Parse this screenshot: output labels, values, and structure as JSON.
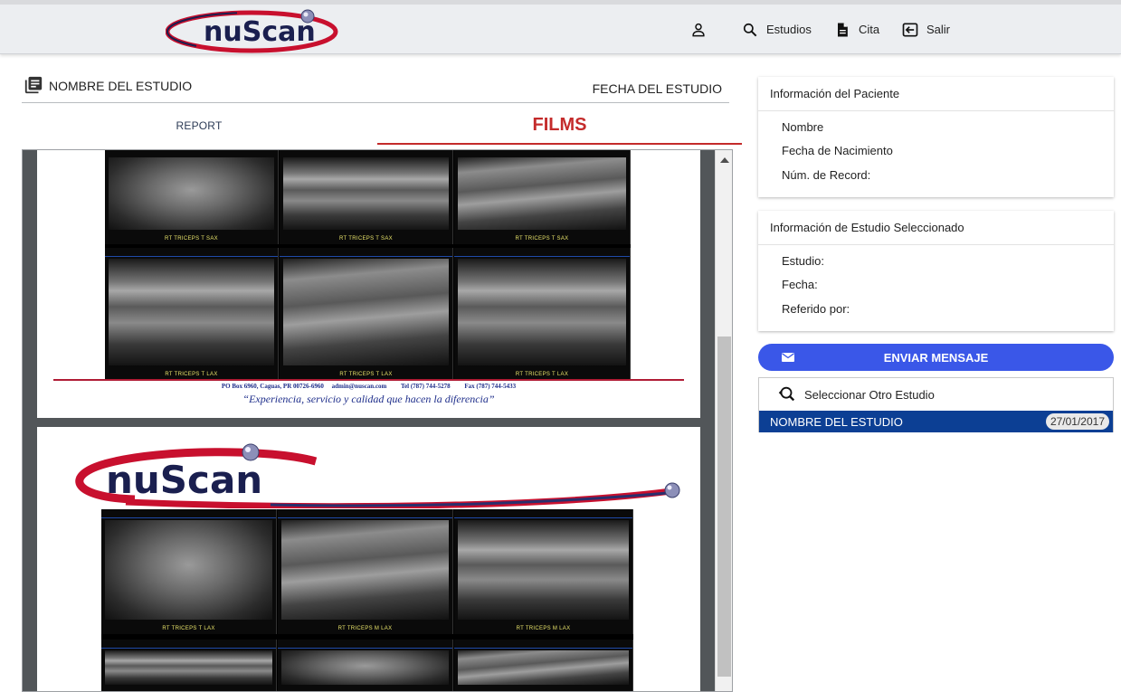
{
  "header": {
    "logo_text": "nuScan",
    "nav": {
      "estudios": "Estudios",
      "cita": "Cita",
      "salir": "Salir"
    },
    "icons": [
      "user-icon",
      "search-icon",
      "document-icon",
      "logout-icon"
    ]
  },
  "study": {
    "name_label": "NOMBRE DEL ESTUDIO",
    "date_label": "FECHA DEL ESTUDIO"
  },
  "tabs": {
    "report": "REPORT",
    "films": "FILMS",
    "active": "films"
  },
  "viewer": {
    "page1": {
      "row1_labels": [
        "RT TRICEPS T SAX",
        "RT TRICEPS T SAX",
        "RT TRICEPS T SAX"
      ],
      "row2_labels": [
        "RT TRICEPS T LAX",
        "RT TRICEPS T LAX",
        "RT TRICEPS T LAX"
      ],
      "footer": {
        "address": "PO Box 6960, Caguas, PR 00726-6960",
        "email": "admin@nuscan.com",
        "tel": "Tel (787) 744-5278",
        "fax": "Fax (787) 744-5433",
        "slogan": "“Experiencia, servicio y calidad que hacen la diferencia”"
      }
    },
    "page2": {
      "logo_text": "nuScan",
      "row1_labels": [
        "RT TRICEPS T LAX",
        "RT TRICEPS M LAX",
        "RT TRICEPS M LAX"
      ]
    }
  },
  "patient_card": {
    "title": "Información del Paciente",
    "fields": [
      "Nombre",
      "Fecha de Nacimiento",
      "Núm. de Record:"
    ]
  },
  "study_card": {
    "title": "Información de Estudio Seleccionado",
    "fields": [
      "Estudio:",
      "Fecha:",
      "Referido por:"
    ]
  },
  "send_button": "ENVIAR MENSAJE",
  "select_study": {
    "label": "Seleccionar Otro Estudio",
    "items": [
      {
        "name": "NOMBRE DEL ESTUDIO",
        "date": "27/01/2017"
      }
    ]
  },
  "colors": {
    "accent_blue": "#3a57e8",
    "selected_row": "#0c3f94",
    "films_red": "#c42b2b",
    "logo_red": "#c8102e",
    "logo_navy": "#1a1f4f"
  }
}
